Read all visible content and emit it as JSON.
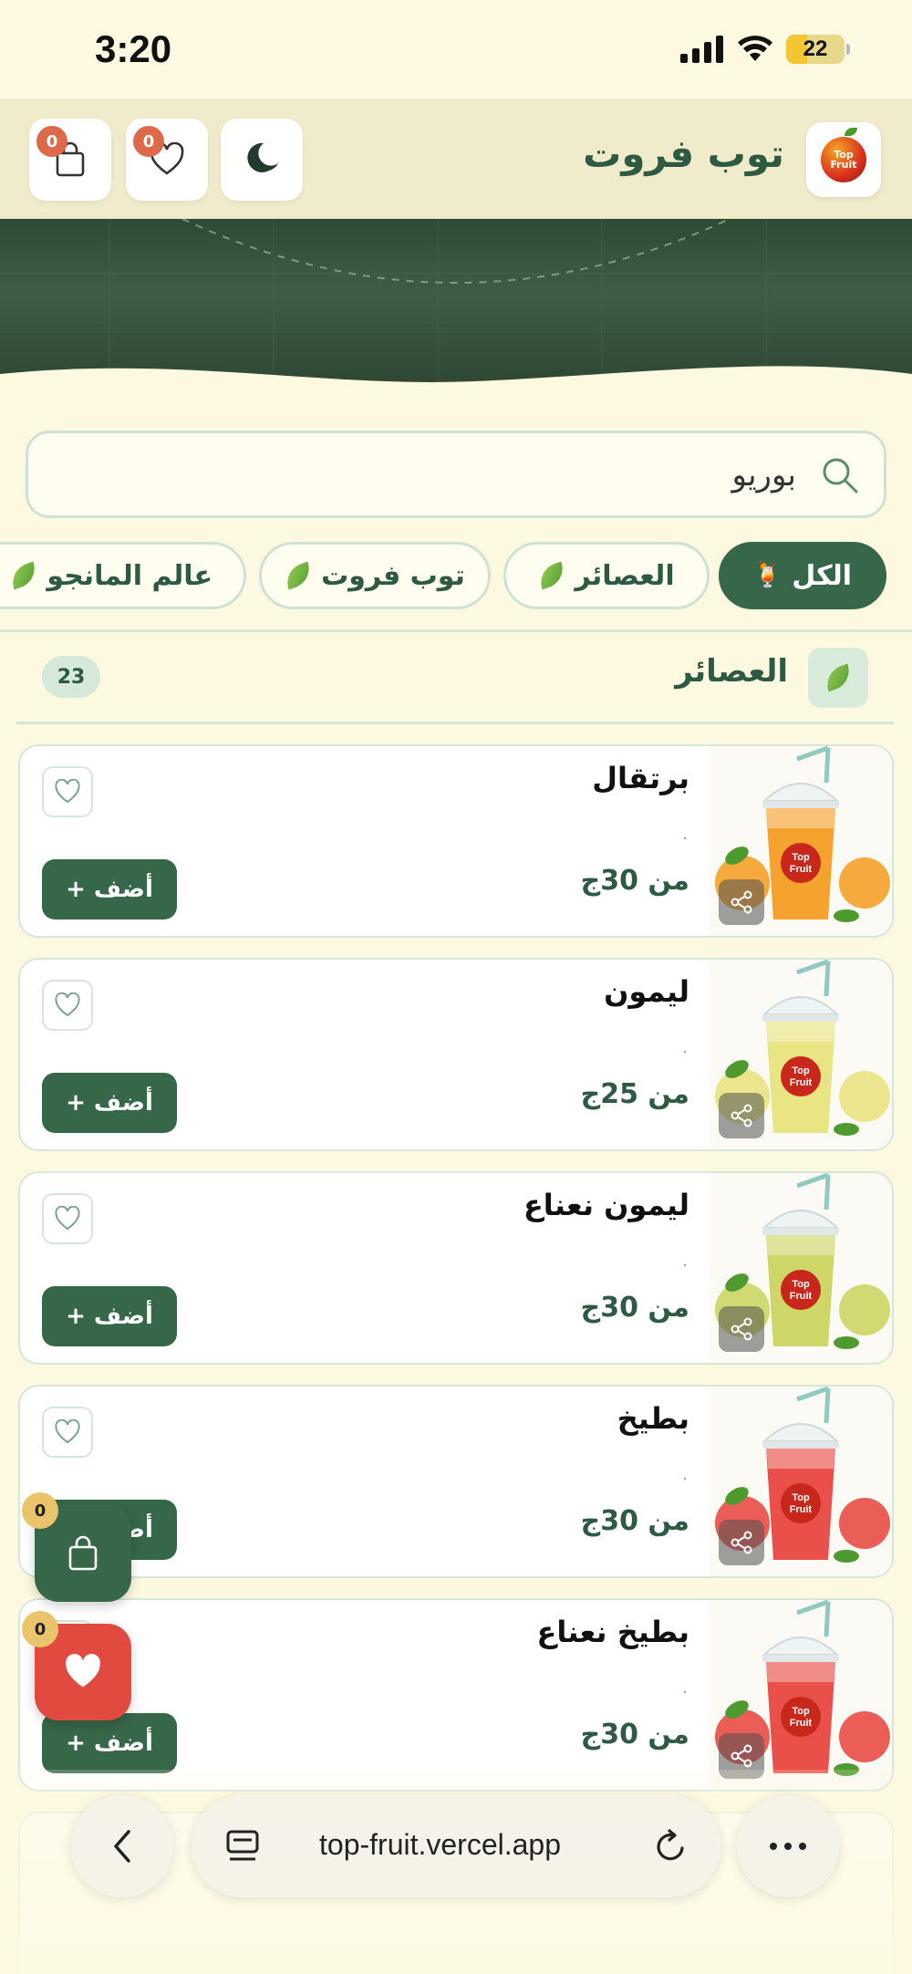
{
  "status_bar": {
    "time": "3:20",
    "battery": "22"
  },
  "header": {
    "title": "توب فروت",
    "logo_text": "Top Fruit",
    "cart_count": "0",
    "favorites_count": "0"
  },
  "search": {
    "value": "بوريو"
  },
  "filters": [
    {
      "label": "الكل",
      "active": true
    },
    {
      "label": "العصائر",
      "active": false
    },
    {
      "label": "توب فروت",
      "active": false
    },
    {
      "label": "عالم المانجو",
      "active": false
    }
  ],
  "section": {
    "title": "العصائر",
    "count": "23"
  },
  "add_label": "+ أضف",
  "products": [
    {
      "name": "برتقال",
      "note": ".",
      "price": "من 30ج",
      "color": "#f49a1c"
    },
    {
      "name": "ليمون",
      "note": ".",
      "price": "من 25ج",
      "color": "#e7e27a"
    },
    {
      "name": "ليمون نعناع",
      "note": ".",
      "price": "من 30ج",
      "color": "#c9d35a"
    },
    {
      "name": "بطيخ",
      "note": ".",
      "price": "من 30ج",
      "color": "#e8413b"
    },
    {
      "name": "بطيخ نعناع",
      "note": ".",
      "price": "من 30ج",
      "color": "#e8413b"
    }
  ],
  "floating": {
    "cart_count": "0",
    "favorites_count": "0"
  },
  "browser": {
    "url": "top-fruit.vercel.app"
  },
  "colors": {
    "primary": "#376749",
    "background": "#fdf9e1",
    "badge": "#dc6a4a",
    "favorite": "#e04a3f"
  }
}
